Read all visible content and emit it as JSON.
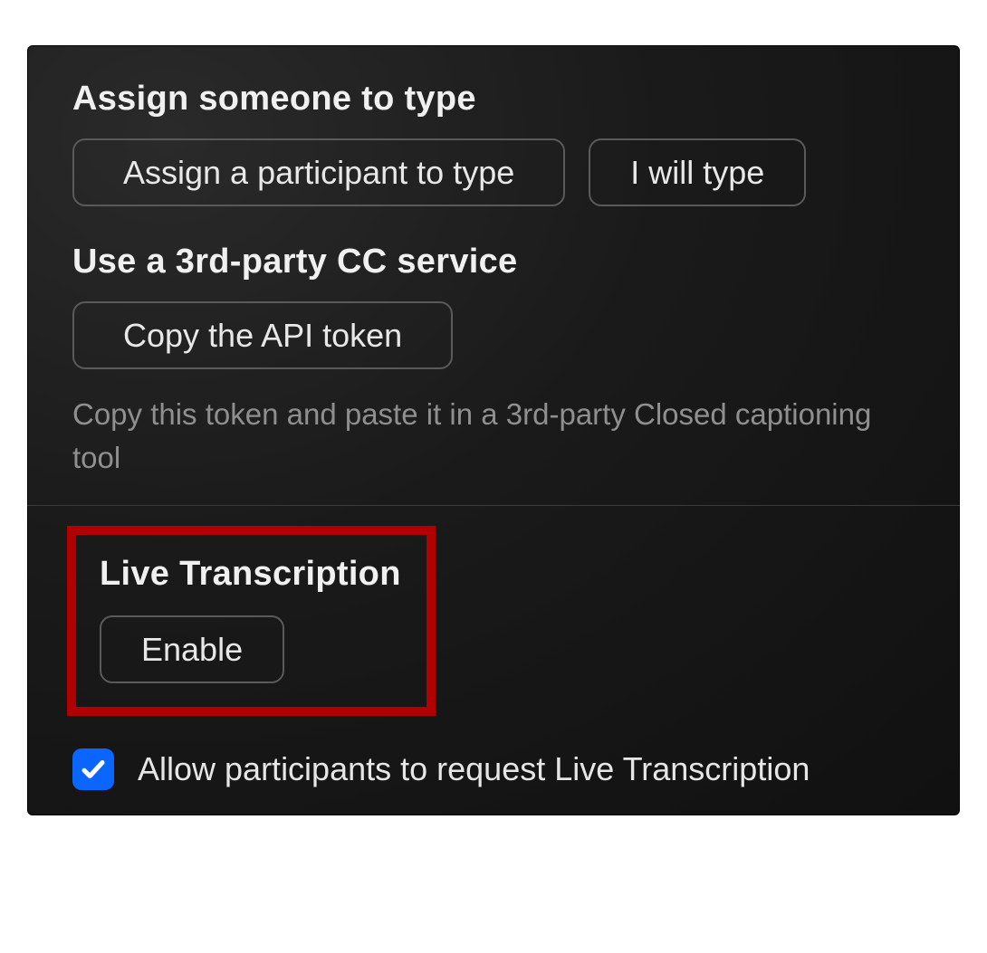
{
  "section1": {
    "heading": "Assign someone to type",
    "assign_button_label": "Assign a participant to type",
    "i_will_type_label": "I will type"
  },
  "section2": {
    "heading": "Use a 3rd-party CC service",
    "copy_button_label": "Copy the API token",
    "helper_text": "Copy this token and paste it in a 3rd-party Closed captioning tool"
  },
  "section3": {
    "heading": "Live Transcription",
    "enable_button_label": "Enable",
    "allow_request_label": "Allow participants to request Live Transcription",
    "allow_request_checked": true
  },
  "colors": {
    "highlight": "#b00000",
    "checkbox": "#0a66ff"
  }
}
